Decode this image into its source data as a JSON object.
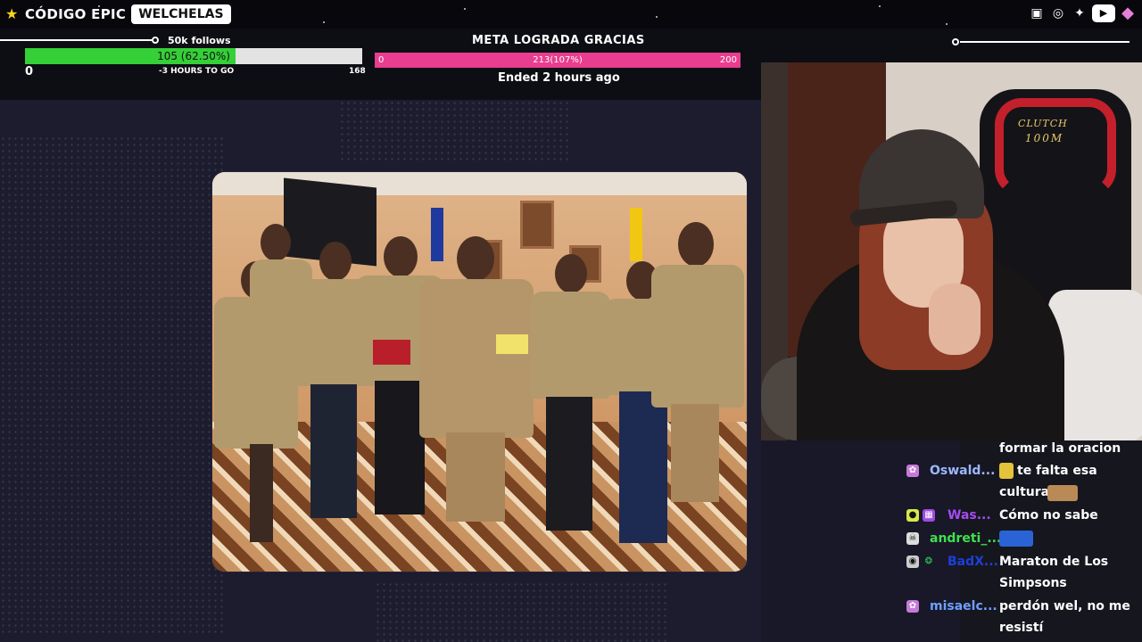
{
  "brand": {
    "name": "CÓDIGO EPIC",
    "channel": "WELCHELAS"
  },
  "socials": [
    "twitch-icon",
    "instagram-icon",
    "twitter-icon",
    "youtube-icon",
    "gem-icon"
  ],
  "colors": {
    "follow_fill": "#35cf38",
    "meta_bar": "#e93d8f",
    "background": "#181828"
  },
  "follow_goal": {
    "title": "50k follows",
    "label": "105 (62.50%)",
    "progress_fraction": 0.625,
    "min": "0",
    "subtext": "-3 HOURS TO GO",
    "max": "168"
  },
  "meta_goal": {
    "title": "META LOGRADA GRACIAS",
    "left": "0",
    "middle": "213(107%)",
    "right": "200",
    "status": "Ended 2 hours ago"
  },
  "webcam": {
    "chair_brand_line1": "CLUTCH",
    "chair_brand_line2": "100M"
  },
  "chat": [
    {
      "user": "",
      "message": "formar la oracion",
      "color": "#ffffff"
    },
    {
      "user": "Oswald...",
      "message": "te falta esa cultura",
      "color": "#9bb8ff"
    },
    {
      "user": "Was...",
      "message": "Cómo no sabe",
      "color": "#a64cf0"
    },
    {
      "user": "andreti_...",
      "message": "",
      "color": "#3fe04f"
    },
    {
      "user": "BadX...",
      "message": "Maraton de Los Simpsons",
      "color": "#1d3fd8"
    },
    {
      "user": "misaelc...",
      "message": "perdón wel, no me resistí",
      "color": "#6f9fff"
    }
  ]
}
